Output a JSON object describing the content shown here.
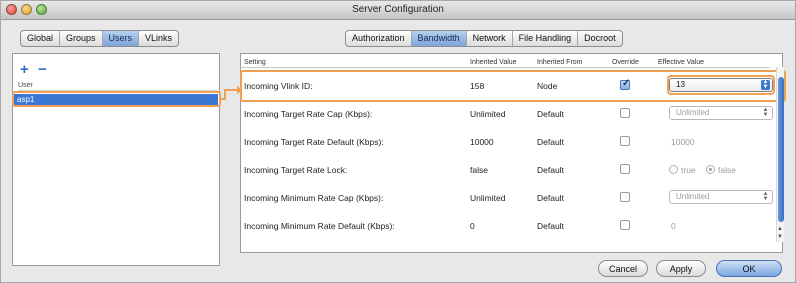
{
  "window": {
    "title": "Server Configuration"
  },
  "left_tabs": [
    {
      "label": "Global",
      "active": false
    },
    {
      "label": "Groups",
      "active": false
    },
    {
      "label": "Users",
      "active": true
    },
    {
      "label": "VLinks",
      "active": false
    }
  ],
  "right_tabs": [
    {
      "label": "Authorization",
      "active": false
    },
    {
      "label": "Bandwidth",
      "active": true
    },
    {
      "label": "Network",
      "active": false
    },
    {
      "label": "File Handling",
      "active": false
    },
    {
      "label": "Docroot",
      "active": false
    }
  ],
  "users": {
    "add_label": "+",
    "remove_label": "−",
    "header": "User",
    "items": [
      "asp1"
    ],
    "selected": "asp1"
  },
  "table": {
    "columns": [
      "Setting",
      "Inherited Value",
      "Inherited From",
      "Override",
      "Effective Value"
    ],
    "rows": [
      {
        "setting": "Incoming Vlink ID:",
        "inherited_value": "158",
        "inherited_from": "Node",
        "override": true,
        "effective": {
          "type": "select",
          "value": "13"
        }
      },
      {
        "setting": "Incoming Target Rate Cap (Kbps):",
        "inherited_value": "Unlimited",
        "inherited_from": "Default",
        "override": false,
        "effective": {
          "type": "select",
          "value": "Unlimited"
        }
      },
      {
        "setting": "Incoming Target Rate Default (Kbps):",
        "inherited_value": "10000",
        "inherited_from": "Default",
        "override": false,
        "effective": {
          "type": "text",
          "value": "10000"
        }
      },
      {
        "setting": "Incoming Target Rate Lock:",
        "inherited_value": "false",
        "inherited_from": "Default",
        "override": false,
        "effective": {
          "type": "radio",
          "options": [
            "true",
            "false"
          ],
          "selected": "false"
        }
      },
      {
        "setting": "Incoming Minimum Rate Cap (Kbps):",
        "inherited_value": "Unlimited",
        "inherited_from": "Default",
        "override": false,
        "effective": {
          "type": "select",
          "value": "Unlimited"
        }
      },
      {
        "setting": "Incoming Minimum Rate Default (Kbps):",
        "inherited_value": "0",
        "inherited_from": "Default",
        "override": false,
        "effective": {
          "type": "text",
          "value": "0"
        }
      }
    ]
  },
  "buttons": {
    "cancel": "Cancel",
    "apply": "Apply",
    "ok": "OK"
  },
  "colors": {
    "highlight": "#f0a050",
    "selection": "#3a78d4",
    "accent": "#2f6fcb"
  }
}
